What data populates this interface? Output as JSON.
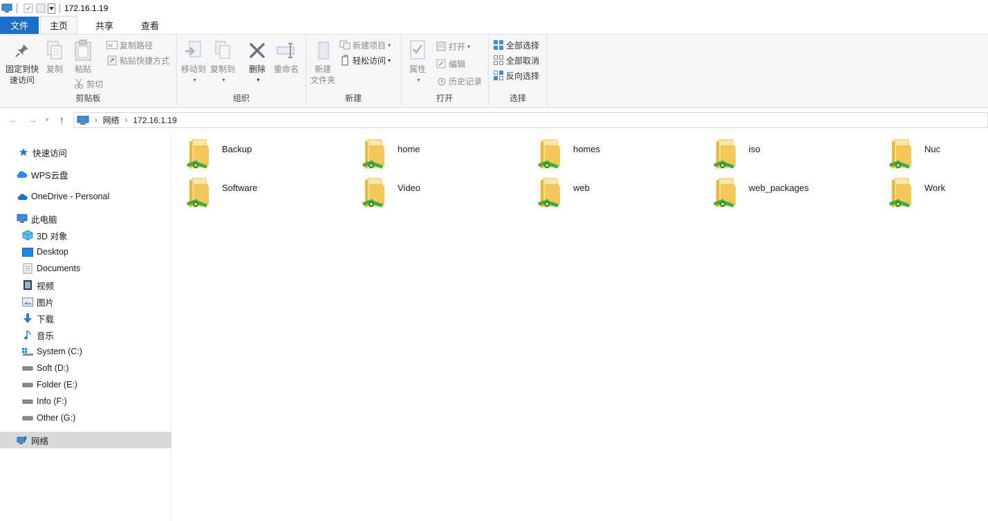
{
  "window": {
    "title": "172.16.1.19"
  },
  "tabs": [
    {
      "label": "文件"
    },
    {
      "label": "主页"
    },
    {
      "label": "共享"
    },
    {
      "label": "查看"
    }
  ],
  "ribbon": {
    "clipboard": {
      "label": "剪贴板",
      "pin_line1": "固定到快",
      "pin_line2": "速访问",
      "copy": "复制",
      "paste": "粘贴",
      "copy_path": "复制路径",
      "paste_shortcut": "粘贴快捷方式",
      "cut": "剪切"
    },
    "organize": {
      "label": "组织",
      "move_to": "移动到",
      "copy_to": "复制到",
      "delete": "删除",
      "rename": "重命名"
    },
    "new": {
      "label": "新建",
      "new_folder_line1": "新建",
      "new_folder_line2": "文件夹",
      "new_item": "新建项目",
      "easy_access": "轻松访问"
    },
    "open": {
      "label": "打开",
      "properties": "属性",
      "open": "打开",
      "edit": "编辑",
      "history": "历史记录"
    },
    "select": {
      "label": "选择",
      "select_all": "全部选择",
      "select_none": "全部取消",
      "invert": "反向选择"
    }
  },
  "address": {
    "crumbs": [
      "网络",
      "172.16.1.19"
    ]
  },
  "sidebar": {
    "quick_access": "快速访问",
    "wps": "WPS云盘",
    "onedrive": "OneDrive - Personal",
    "this_pc": "此电脑",
    "items": [
      {
        "label": "3D 对象",
        "icon": "3d-objects-icon"
      },
      {
        "label": "Desktop",
        "icon": "desktop-icon"
      },
      {
        "label": "Documents",
        "icon": "documents-icon"
      },
      {
        "label": "视频",
        "icon": "videos-icon"
      },
      {
        "label": "图片",
        "icon": "pictures-icon"
      },
      {
        "label": "下载",
        "icon": "downloads-icon"
      },
      {
        "label": "音乐",
        "icon": "music-icon"
      },
      {
        "label": "System (C:)",
        "icon": "system-drive-icon"
      },
      {
        "label": "Soft (D:)",
        "icon": "drive-icon"
      },
      {
        "label": "Folder (E:)",
        "icon": "drive-icon"
      },
      {
        "label": "Info (F:)",
        "icon": "drive-icon"
      },
      {
        "label": "Other (G:)",
        "icon": "drive-icon"
      }
    ],
    "network": "网络"
  },
  "shares": [
    {
      "name": "Backup"
    },
    {
      "name": "home"
    },
    {
      "name": "homes"
    },
    {
      "name": "iso"
    },
    {
      "name": "Nuc"
    },
    {
      "name": "Software"
    },
    {
      "name": "Video"
    },
    {
      "name": "web"
    },
    {
      "name": "web_packages"
    },
    {
      "name": "Work"
    }
  ],
  "colors": {
    "accent": "#1a6fc8",
    "folder": "#f4c75a",
    "share_badge": "#3fae3a",
    "selected": "#d9d9d9"
  }
}
